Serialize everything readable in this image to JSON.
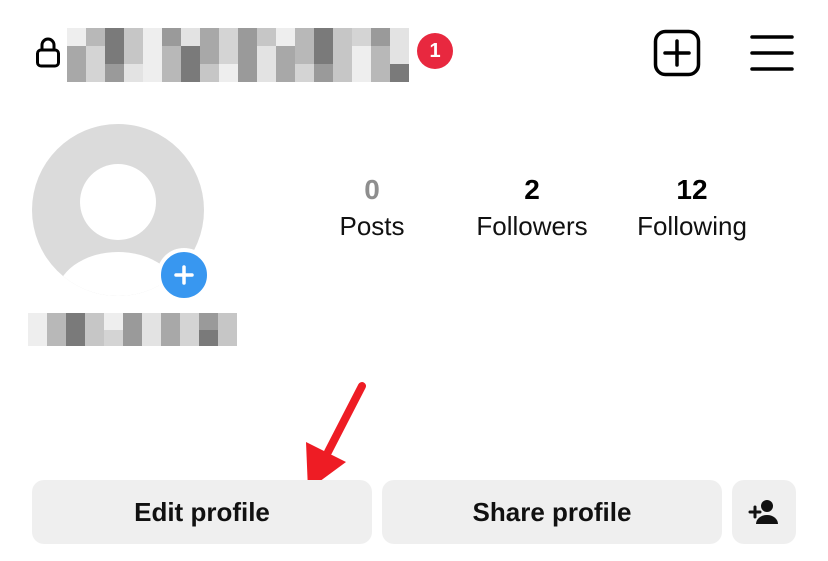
{
  "header": {
    "username": "",
    "notification_count": "1",
    "icons": {
      "lock": "lock-icon",
      "new_post": "plus-square-icon",
      "menu": "hamburger-menu-icon"
    },
    "colors": {
      "badge": "#e8283f"
    }
  },
  "profile": {
    "display_name": "",
    "avatar_icon": "default-avatar-icon",
    "add_story_icon": "plus-icon",
    "accent_color": "#3897f0"
  },
  "stats": {
    "posts": {
      "count": "0",
      "label": "Posts"
    },
    "followers": {
      "count": "2",
      "label": "Followers"
    },
    "following": {
      "count": "12",
      "label": "Following"
    }
  },
  "actions": {
    "edit_profile_label": "Edit profile",
    "share_profile_label": "Share profile",
    "add_friend_icon": "person-add-icon"
  },
  "annotation": {
    "color": "#ee1c24",
    "icon": "red-arrow-icon"
  }
}
